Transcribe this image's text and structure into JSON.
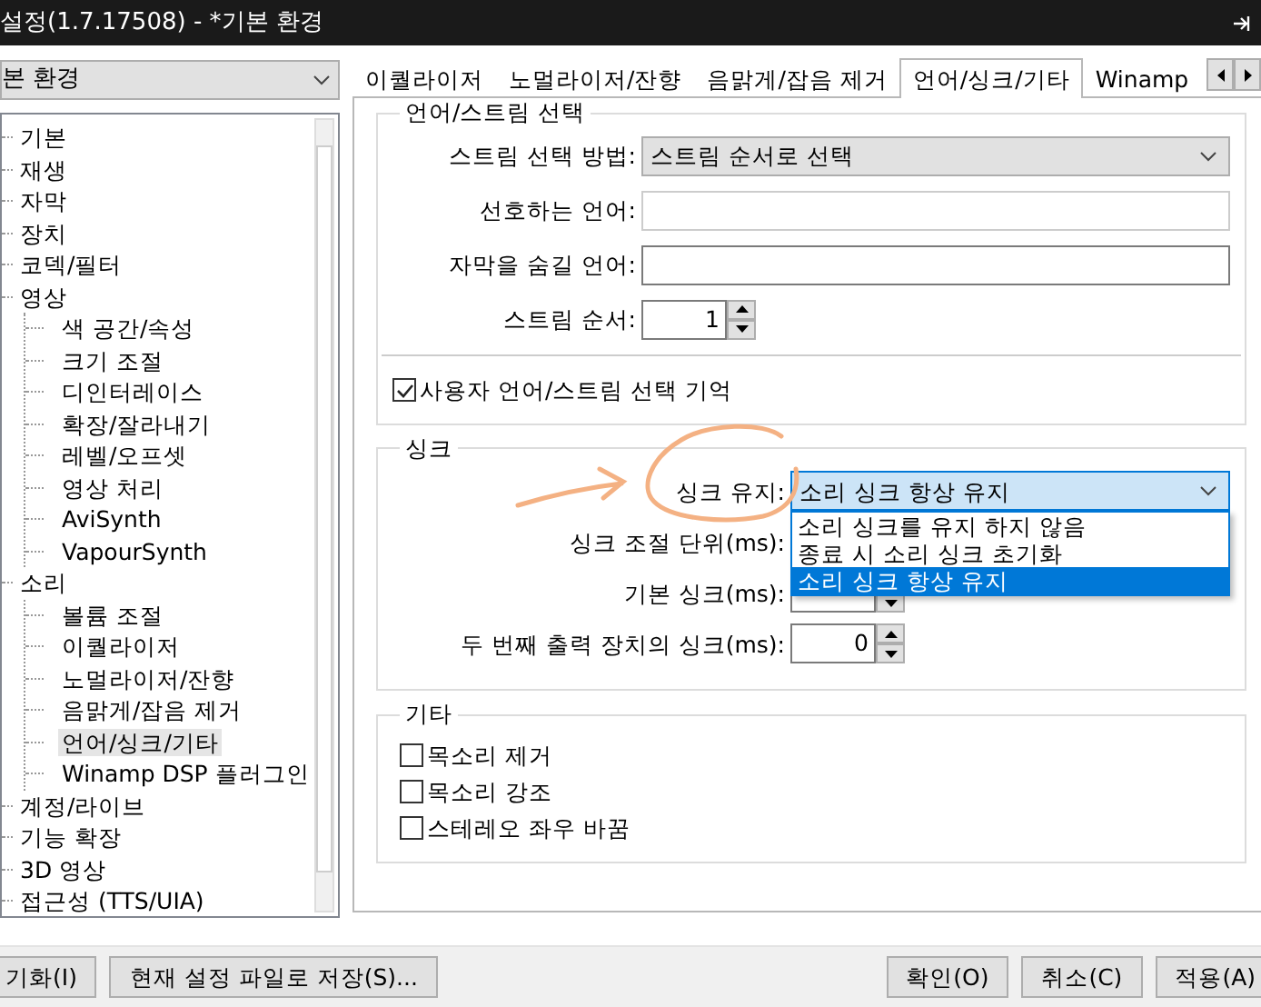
{
  "window": {
    "title": "설정(1.7.17508) - *기본 환경"
  },
  "category_select": {
    "value": "본 환경"
  },
  "tree": [
    {
      "label": "기본",
      "selected": false
    },
    {
      "label": "재생",
      "selected": false
    },
    {
      "label": "자막",
      "selected": false
    },
    {
      "label": "장치",
      "selected": false
    },
    {
      "label": "코덱/필터",
      "selected": false
    },
    {
      "label": "영상",
      "selected": false,
      "children": [
        {
          "label": "색 공간/속성",
          "selected": false
        },
        {
          "label": "크기 조절",
          "selected": false
        },
        {
          "label": "디인터레이스",
          "selected": false
        },
        {
          "label": "확장/잘라내기",
          "selected": false
        },
        {
          "label": "레벨/오프셋",
          "selected": false
        },
        {
          "label": "영상 처리",
          "selected": false
        },
        {
          "label": "AviSynth",
          "selected": false
        },
        {
          "label": "VapourSynth",
          "selected": false
        }
      ]
    },
    {
      "label": "소리",
      "selected": false,
      "children": [
        {
          "label": "볼륨 조절",
          "selected": false
        },
        {
          "label": "이퀄라이저",
          "selected": false
        },
        {
          "label": "노멀라이저/잔향",
          "selected": false
        },
        {
          "label": "음맑게/잡음 제거",
          "selected": false
        },
        {
          "label": "언어/싱크/기타",
          "selected": true
        },
        {
          "label": "Winamp DSP 플러그인",
          "selected": false
        }
      ]
    },
    {
      "label": "계정/라이브",
      "selected": false
    },
    {
      "label": "기능 확장",
      "selected": false
    },
    {
      "label": "3D 영상",
      "selected": false
    },
    {
      "label": "접근성 (TTS/UIA)",
      "selected": false
    }
  ],
  "tabs": [
    {
      "label": "이퀄라이저",
      "selected": false
    },
    {
      "label": "노멀라이저/잔향",
      "selected": false
    },
    {
      "label": "음맑게/잡음 제거",
      "selected": false
    },
    {
      "label": "언어/싱크/기타",
      "selected": true
    },
    {
      "label": "Winamp",
      "selected": false
    }
  ],
  "groups": [
    {
      "title": "언어/스트림 선택",
      "rows": [
        {
          "kind": "select",
          "label": "스트림 선택 방법:",
          "value": "스트림 순서로 선택",
          "open": false
        },
        {
          "kind": "text",
          "label": "선호하는 언어:",
          "disabled": true
        },
        {
          "kind": "text",
          "label": "자막을 숨길 언어:",
          "disabled": false
        },
        {
          "kind": "spin",
          "label": "스트림 순서:",
          "value": "1"
        },
        {
          "kind": "check",
          "label": "사용자 언어/스트림 선택 기억",
          "checked": true
        }
      ]
    },
    {
      "title": "싱크",
      "rows": [
        {
          "kind": "select",
          "label": "싱크 유지:",
          "value": "소리 싱크 항상 유지",
          "open": true,
          "options": [
            {
              "label": "소리 싱크를 유지 하지 않음",
              "selected": false
            },
            {
              "label": "종료 시 소리 싱크 초기화",
              "selected": false
            },
            {
              "label": "소리 싱크 항상 유지",
              "selected": true
            }
          ]
        },
        {
          "kind": "covered",
          "label": "싱크 조절 단위(ms):"
        },
        {
          "kind": "spin_lower",
          "label": "기본 싱크(ms):"
        },
        {
          "kind": "spin",
          "label": "두 번째 출력 장치의 싱크(ms):",
          "value": "0"
        }
      ]
    },
    {
      "title": "기타",
      "rows": [
        {
          "kind": "check",
          "label": "목소리 제거",
          "checked": false
        },
        {
          "kind": "check",
          "label": "목소리 강조",
          "checked": false
        },
        {
          "kind": "check",
          "label": "스테레오 좌우 바꿈",
          "checked": false
        }
      ]
    }
  ],
  "buttons_left": [
    "기화(I)",
    "현재 설정 파일로 저장(S)..."
  ],
  "buttons_right": [
    "확인(O)",
    "취소(C)",
    "적용(A)"
  ]
}
